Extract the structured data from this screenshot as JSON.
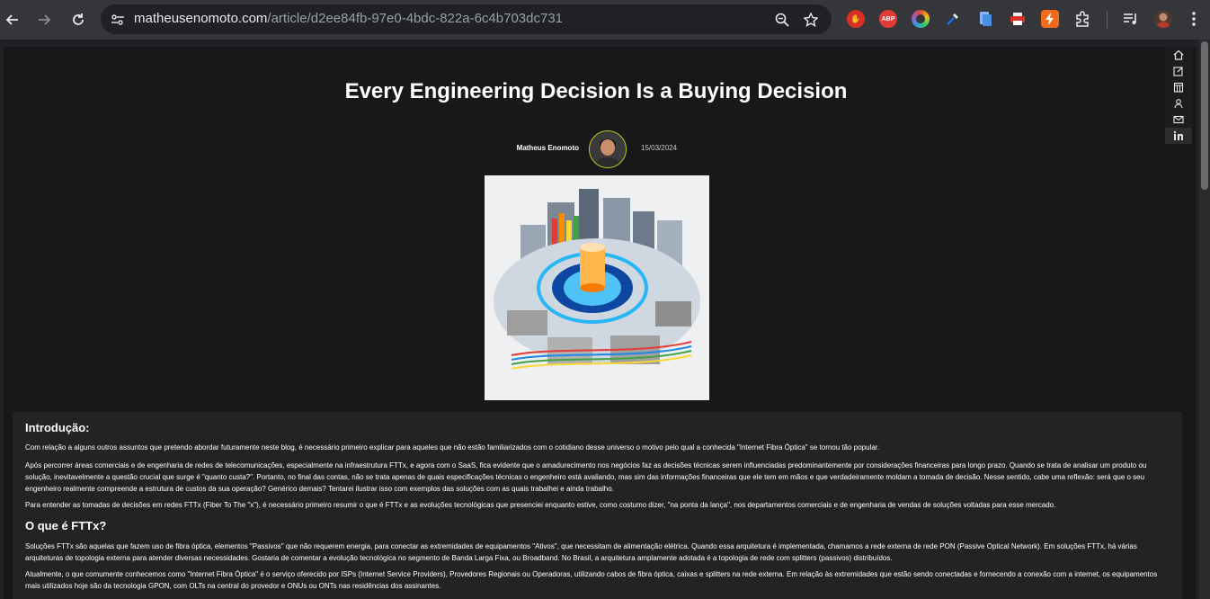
{
  "browser": {
    "url_host": "matheusenomoto.com",
    "url_path": "/article/d2ee84fb-97e0-4bdc-822a-6c4b703dc731",
    "extensions": [
      {
        "name": "hand-stop-extension",
        "label": "",
        "color": "#d93025"
      },
      {
        "name": "adblock-plus-extension",
        "label": "ABP",
        "color": "#e43a3a"
      },
      {
        "name": "color-picker-extension",
        "label": "",
        "color": "#3d9bd6"
      },
      {
        "name": "eyedropper-extension",
        "label": "",
        "color": "#1a73e8"
      },
      {
        "name": "docs-extension",
        "label": "",
        "color": "#4a90e2"
      },
      {
        "name": "print-extension",
        "label": "",
        "color": "#c0c0c0"
      },
      {
        "name": "bolt-extension",
        "label": "",
        "color": "#f26b1d"
      }
    ]
  },
  "article": {
    "title": "Every Engineering Decision Is a Buying Decision",
    "author": "Matheus Enomoto",
    "date": "15/03/2024"
  },
  "side_nav": [
    "home-icon",
    "edit-icon",
    "calendar-icon",
    "user-icon",
    "mail-icon",
    "linkedin-icon"
  ],
  "content": {
    "intro_heading": "Introdução:",
    "p1": "Com relação a alguns outros assuntos que pretendo abordar futuramente neste blog, é necessário primeiro explicar para aqueles que não estão familiarizados com o cotidiano desse universo o motivo pelo qual a conhecida \"Internet Fibra Óptica\" se tornou tão popular.",
    "p2": "Após percorrer áreas comerciais e de engenharia de redes de telecomunicações, especialmente na infraestrutura FTTx, e agora com o SaaS, fica evidente que o amadurecimento nos negócios faz as decisões técnicas serem influenciadas predominantemente por considerações financeiras para longo prazo. Quando se trata de analisar um produto ou solução, inevitavelmente a questão crucial que surge é \"quanto custa?\". Portanto, no final das contas, não se trata apenas de quais especificações técnicas o engenheiro está avaliando, mas sim das informações financeiras que ele tem em mãos e que verdadeiramente moldam a tomada de decisão. Nesse sentido, cabe uma reflexão: será que o seu engenheiro realmente compreende a estrutura de custos da sua operação? Genérico demais? Tentarei ilustrar isso com exemplos das soluções com as quais trabalhei e ainda trabalho.",
    "p3": "Para entender as tomadas de decisões em redes FTTx (Fiber To The \"x\"), é necessário primeiro resumir o que é FTTx e as evoluções tecnológicas que presenciei enquanto estive, como costumo dizer, \"na ponta da lança\", nos departamentos comerciais e de engenharia de vendas de soluções voltadas para esse mercado.",
    "fttx_heading": "O que é FTTx?",
    "p4": "Soluções FTTx são aquelas que fazem uso de fibra óptica, elementos \"Passivos\" que não requerem energia, para conectar as extremidades de equipamentos \"Ativos\", que necessitam de alimentação elétrica. Quando essa arquitetura é implementada, chamamos a rede externa de rede PON (Passive Optical Network). Em soluções FTTx, há várias arquiteturas de topologia externa para atender diversas necessidades. Gostaria de comentar a evolução tecnológica no segmento de Banda Larga Fixa, ou Broadband. No Brasil, a arquitetura amplamente adotada é a topologia de rede com splitters (passivos) distribuídos.",
    "p5": "Atualmente, o que comumente conhecemos como \"Internet Fibra Óptica\" é o serviço oferecido por ISPs (Internet Service Providers), Provedores Regionais ou Operadoras, utilizando cabos de fibra óptica, caixas e splitters na rede externa. Em relação às extremidades que estão sendo conectadas e fornecendo a conexão com a internet, os equipamentos mais utilizados hoje são da tecnologia GPON, com OLTs na central do provedor e ONUs ou ONTs nas residências dos assinantes."
  }
}
